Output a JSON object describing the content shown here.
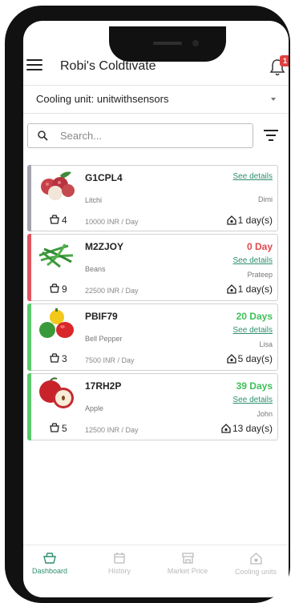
{
  "app": {
    "title": "Robi's Coldtivate",
    "notification_count": "1"
  },
  "cooling_unit": {
    "label": "Cooling unit: unitwithsensors"
  },
  "search": {
    "placeholder": "Search..."
  },
  "crates": [
    {
      "code": "G1CPL4",
      "crop": "Litchi",
      "crates": "4",
      "price": "10000 INR / Day",
      "status": "",
      "status_color": "",
      "details": "See details",
      "owner": "Dimi",
      "stay": "1 day(s)",
      "bar_color": "#a3a3ad",
      "image": "litchi-image"
    },
    {
      "code": "M2ZJOY",
      "crop": "Beans",
      "crates": "9",
      "price": "22500 INR / Day",
      "status": "0 Day",
      "status_color": "#e0474c",
      "details": "See details",
      "owner": "Prateep",
      "stay": "1 day(s)",
      "bar_color": "#e05562",
      "image": "beans-image"
    },
    {
      "code": "PBIF79",
      "crop": "Bell Pepper",
      "crates": "3",
      "price": "7500 INR / Day",
      "status": "20 Days",
      "status_color": "#3fbf5a",
      "details": "See details",
      "owner": "Lisa",
      "stay": "5 day(s)",
      "bar_color": "#5cc96c",
      "image": "bell-pepper-image"
    },
    {
      "code": "17RH2P",
      "crop": "Apple",
      "crates": "5",
      "price": "12500 INR / Day",
      "status": "39 Days",
      "status_color": "#3fbf5a",
      "details": "See details",
      "owner": "John",
      "stay": "13 day(s)",
      "bar_color": "#5cc96c",
      "image": "apple-image"
    }
  ],
  "nav": [
    {
      "label": "Dashboard",
      "icon": "crate-icon",
      "active": true
    },
    {
      "label": "History",
      "icon": "calendar-icon",
      "active": false
    },
    {
      "label": "Market Price",
      "icon": "store-icon",
      "active": false
    },
    {
      "label": "Cooling units",
      "icon": "cooling-unit-icon",
      "active": false
    }
  ],
  "colors": {
    "accent": "#2e8f6d",
    "danger": "#e0474c",
    "success": "#3fbf5a"
  }
}
